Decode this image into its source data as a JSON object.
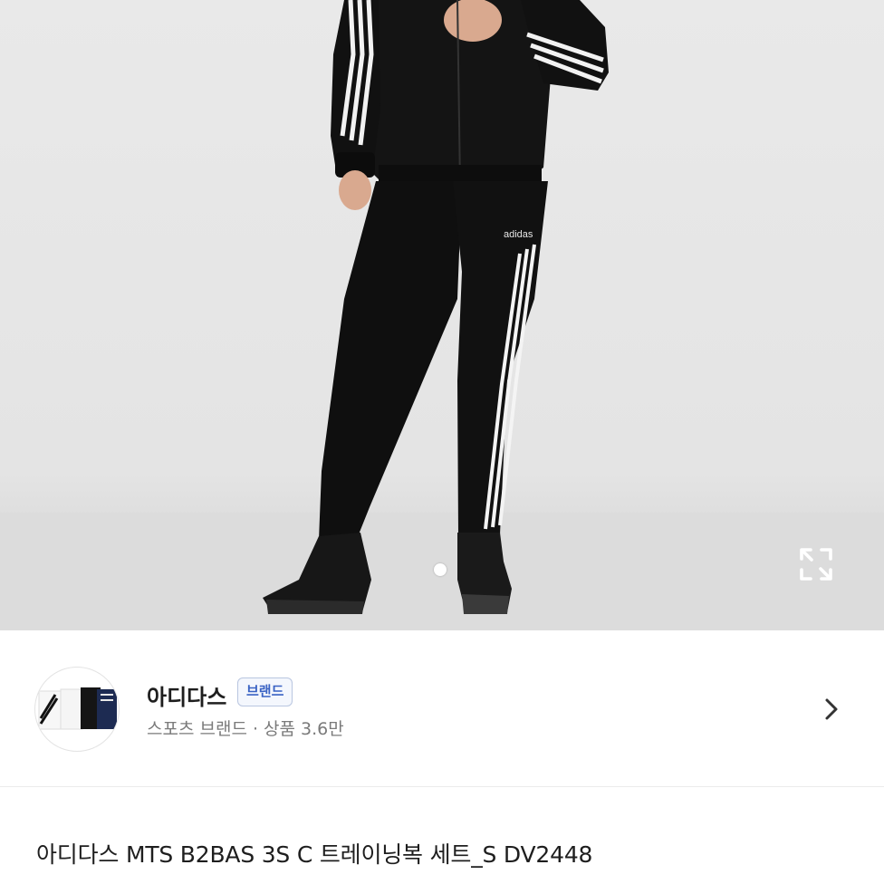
{
  "product_image": {
    "alt": "",
    "page_dot_color": "#ffffff"
  },
  "icons": {
    "expand": "expand-arrows-icon",
    "chevron": "chevron-right-icon"
  },
  "brand": {
    "name": "아디다스",
    "badge": "브랜드",
    "meta": "스포츠 브랜드 · 상품 3.6만",
    "badge_color": "#3a63c4"
  },
  "product": {
    "title": "아디다스 MTS B2BAS 3S C 트레이닝복 세트_S DV2448"
  },
  "garment_logo_text": "adidas"
}
